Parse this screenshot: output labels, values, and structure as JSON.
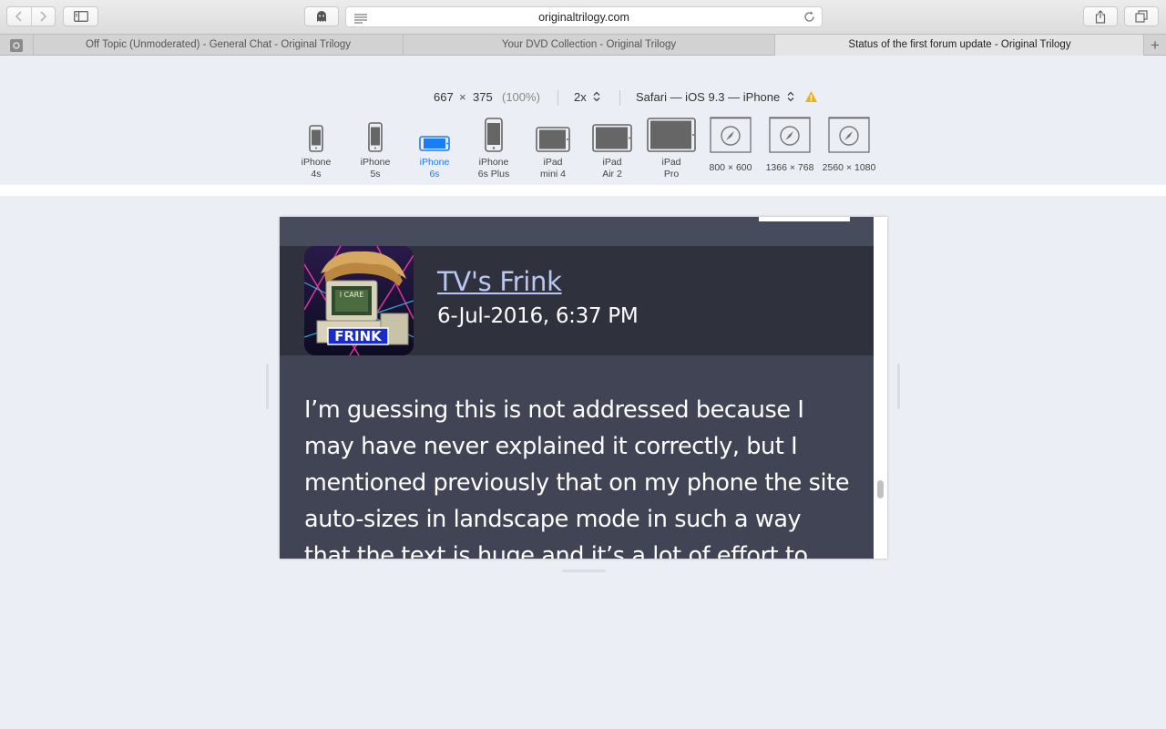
{
  "browser": {
    "url": "originaltrilogy.com",
    "tabs": [
      {
        "label": "Off Topic (Unmoderated) - General Chat - Original Trilogy",
        "active": false
      },
      {
        "label": "Your DVD Collection - Original Trilogy",
        "active": false
      },
      {
        "label": "Status of the first forum update - Original Trilogy",
        "active": true
      }
    ],
    "new_tab_icon": "plus-icon"
  },
  "responsive": {
    "width": "667",
    "times": "×",
    "height": "375",
    "zoom": "(100%)",
    "scale": "2x",
    "user_agent": "Safari — iOS 9.3 — iPhone",
    "warning_color": "#f0b400",
    "selected_color": "#1b7cf5",
    "devices": [
      {
        "label": "iPhone\n4s",
        "icon": "phone-portrait-icon"
      },
      {
        "label": "iPhone\n5s",
        "icon": "phone-portrait-icon"
      },
      {
        "label": "iPhone\n6s",
        "icon": "phone-landscape-icon",
        "selected": true
      },
      {
        "label": "iPhone\n6s Plus",
        "icon": "phone-portrait-icon"
      },
      {
        "label": "iPad\nmini 4",
        "icon": "tablet-landscape-icon"
      },
      {
        "label": "iPad\nAir 2",
        "icon": "tablet-landscape-icon"
      },
      {
        "label": "iPad\nPro",
        "icon": "tablet-landscape-icon"
      },
      {
        "label": "800 × 600",
        "icon": "compass-icon"
      },
      {
        "label": "1366 × 768",
        "icon": "compass-icon"
      },
      {
        "label": "2560 × 1080",
        "icon": "compass-icon"
      }
    ]
  },
  "post": {
    "author": "TV's Frink",
    "date": "6-Jul-2016, 6:37 PM",
    "avatar_text": "FRINK",
    "avatar_screen_text": "I CARE",
    "body": "I’m guessing this is not addressed because I may have never explained it correctly, but I mentioned previously that on my phone the site auto-sizes in landscape mode in such a way that the text is huge and it’s a lot of effort to scroll past anything. And"
  }
}
